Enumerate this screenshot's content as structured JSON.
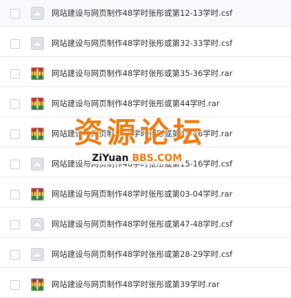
{
  "files": [
    {
      "name": "网站建设与网页制作48学时张彤或第12-13学时.csf",
      "icon": "cloud-file-icon"
    },
    {
      "name": "网站建设与网页制作48学时张彤或第32-33学时.csf",
      "icon": "cloud-file-icon"
    },
    {
      "name": "网站建设与网页制作48学时张彤或第35-36学时.rar",
      "icon": "rar-archive-icon"
    },
    {
      "name": "网站建设与网页制作48学时张彤或第44学时.rar",
      "icon": "rar-archive-icon"
    },
    {
      "name": "网站建设与网页制作48学时张彤或第45-46学时.rar",
      "icon": "rar-archive-icon"
    },
    {
      "name": "网站建设与网页制作48学时张彤或第15-16学时.csf",
      "icon": "cloud-file-icon"
    },
    {
      "name": "网站建设与网页制作48学时张彤或第03-04学时.rar",
      "icon": "rar-archive-icon"
    },
    {
      "name": "网站建设与网页制作48学时张彤或第47-48学时.csf",
      "icon": "cloud-file-icon"
    },
    {
      "name": "网站建设与网页制作48学时张彤或第28-29学时.csf",
      "icon": "cloud-file-icon"
    },
    {
      "name": "网站建设与网页制作48学时张彤或第39学时.rar",
      "icon": "rar-archive-icon"
    }
  ],
  "watermark": {
    "title": "资源论坛",
    "url_prefix": "ZiYuan",
    "url_suffix": "BBS.COM"
  },
  "colors": {
    "watermark_orange": "#f07d13",
    "text": "#333333",
    "row_border": "#e6e9ee"
  }
}
